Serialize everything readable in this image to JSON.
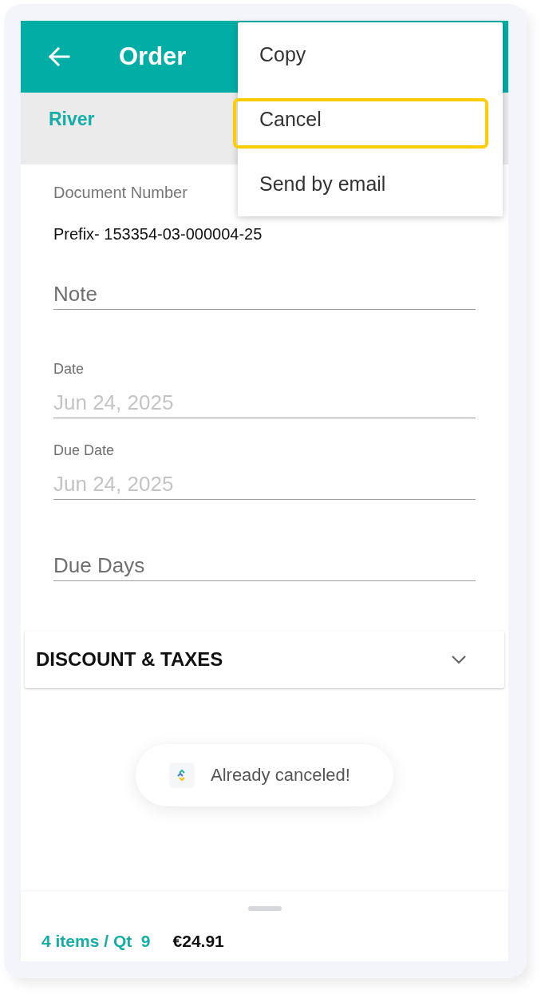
{
  "app_bar": {
    "title": "Order"
  },
  "customer": {
    "name": "River"
  },
  "document_number": {
    "label": "Document Number",
    "value": "Prefix- 153354-03-000004-25"
  },
  "fields": [
    {
      "placeholder": "Note"
    },
    {
      "label": "Date",
      "value": "Jun 24, 2025",
      "disabled": true
    },
    {
      "label": "Due Date",
      "value": "Jun 24, 2025",
      "disabled": true
    },
    {
      "placeholder": "Due Days"
    }
  ],
  "sections": [
    {
      "title": "DISCOUNT & TAXES",
      "expanded": false
    }
  ],
  "toast": {
    "message": "Already canceled!"
  },
  "summary": {
    "items": "4 items / Qt  9",
    "total": "€24.91"
  },
  "menu": {
    "items": [
      {
        "label": "Copy",
        "highlighted": false
      },
      {
        "label": "Cancel",
        "highlighted": true
      },
      {
        "label": "Send by email",
        "highlighted": false
      }
    ]
  }
}
